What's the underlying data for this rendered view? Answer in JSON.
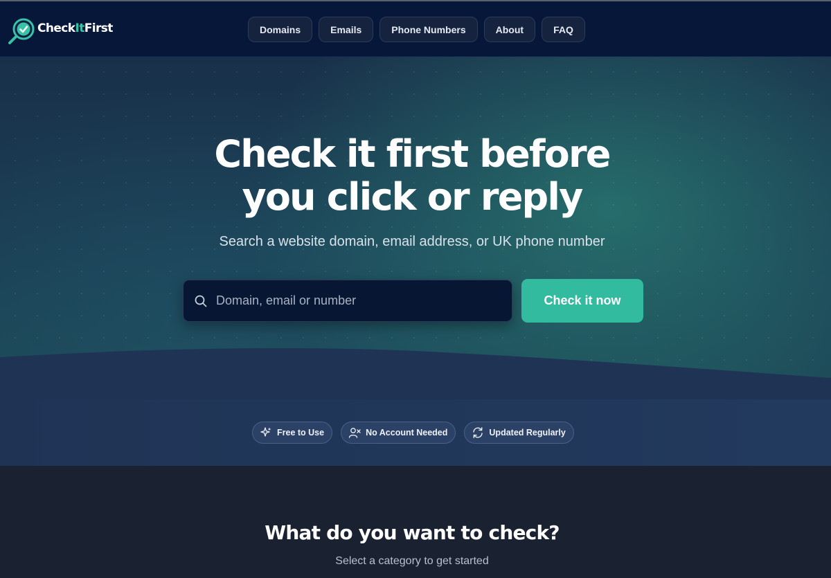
{
  "header": {
    "logo": {
      "text_main": "Check",
      "text_accent": "It",
      "text_end": "First"
    },
    "nav": [
      {
        "label": "Domains"
      },
      {
        "label": "Emails"
      },
      {
        "label": "Phone Numbers"
      },
      {
        "label": "About"
      },
      {
        "label": "FAQ"
      }
    ]
  },
  "hero": {
    "headline_line1": "Check it first before",
    "headline_line2": "you click or reply",
    "subhead": "Search a website domain, email address, or UK phone number",
    "search": {
      "placeholder": "Domain, email or number",
      "value": "",
      "icon": "search-icon"
    },
    "cta_label": "Check it now"
  },
  "badges": [
    {
      "label": "Free to Use",
      "icon": "sparkles-icon"
    },
    {
      "label": "No Account Needed",
      "icon": "user-x-icon"
    },
    {
      "label": "Updated Regularly",
      "icon": "refresh-icon"
    }
  ],
  "section": {
    "title": "What do you want to check?",
    "subtitle": "Select a category to get started"
  },
  "colors": {
    "header_bg": "#07173a",
    "accent": "#33bba0",
    "search_bg": "#071633",
    "badge_bg": "#2c4166",
    "section_bg": "#1a2130"
  }
}
